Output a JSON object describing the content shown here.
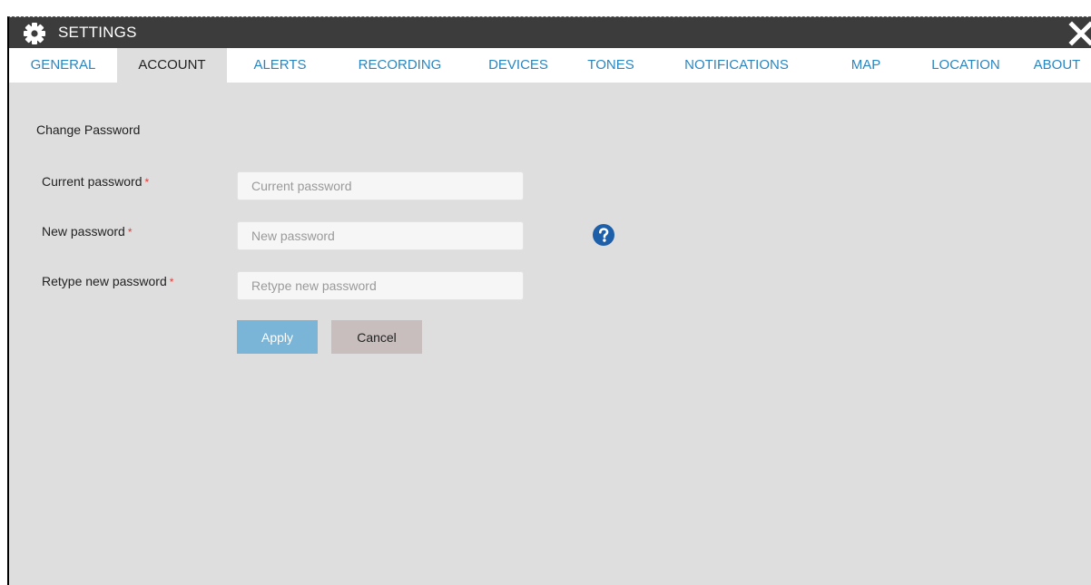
{
  "window": {
    "title": "SETTINGS",
    "title_icon": "gear-icon",
    "close_icon": "close-icon"
  },
  "tabs": [
    {
      "label": "GENERAL",
      "active": false
    },
    {
      "label": "ACCOUNT",
      "active": true
    },
    {
      "label": "ALERTS",
      "active": false
    },
    {
      "label": "RECORDING",
      "active": false
    },
    {
      "label": "DEVICES",
      "active": false
    },
    {
      "label": "TONES",
      "active": false
    },
    {
      "label": "NOTIFICATIONS",
      "active": false
    },
    {
      "label": "MAP",
      "active": false
    },
    {
      "label": "LOCATION",
      "active": false
    },
    {
      "label": "ABOUT",
      "active": false
    }
  ],
  "form": {
    "section_title": "Change Password",
    "required_marker": "*",
    "fields": [
      {
        "label": "Current password",
        "placeholder": "Current password",
        "value": ""
      },
      {
        "label": "New password",
        "placeholder": "New password",
        "value": ""
      },
      {
        "label": "Retype new password",
        "placeholder": "Retype new password",
        "value": ""
      }
    ],
    "help_icon": "question-circle-icon",
    "apply_label": "Apply",
    "cancel_label": "Cancel"
  },
  "colors": {
    "titlebar_bg": "#3c3c3c",
    "tab_text": "#2a86c0",
    "panel_bg": "#dedede",
    "required": "#e53935",
    "apply_bg": "#7ab4d6",
    "cancel_bg": "#c8bebe",
    "help_icon": "#1d5fa8"
  }
}
